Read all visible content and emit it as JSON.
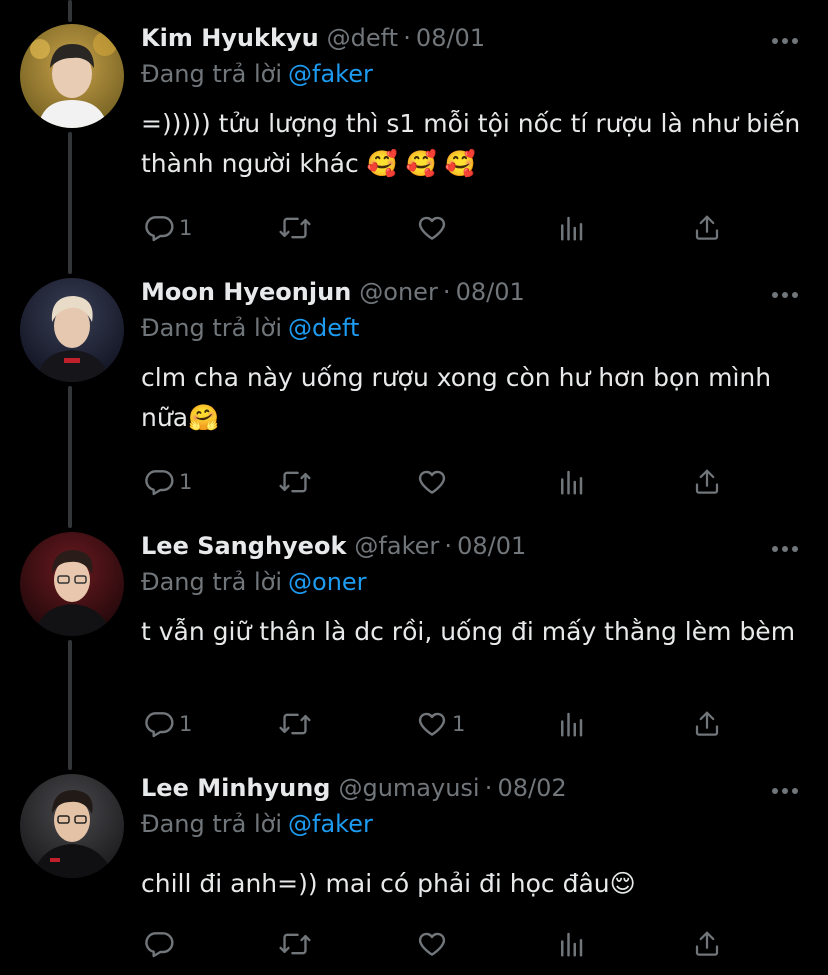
{
  "reply_prefix": "Đang trả lời",
  "tweets": [
    {
      "name": "Kim Hyukkyu",
      "handle": "@deft",
      "dot": "·",
      "date": "08/01",
      "reply_to": "@faker",
      "text": "=))))) tửu lượng thì s1 mỗi tội nốc tí rượu là như biến thành người khác 🥰 🥰 🥰",
      "replies": "1",
      "retweets": "",
      "likes": ""
    },
    {
      "name": "Moon Hyeonjun",
      "handle": "@oner",
      "dot": "·",
      "date": "08/01",
      "reply_to": "@deft",
      "text": "clm cha này uống rượu xong còn hư hơn bọn mình nữa🤗",
      "replies": "1",
      "retweets": "",
      "likes": ""
    },
    {
      "name": "Lee Sanghyeok",
      "handle": "@faker",
      "dot": "·",
      "date": "08/01",
      "reply_to": "@oner",
      "text": "t vẫn giữ thân là dc rồi, uống đi mấy thằng lèm bèm",
      "replies": "1",
      "retweets": "",
      "likes": "1"
    },
    {
      "name": "Lee Minhyung",
      "handle": "@gumayusi",
      "dot": "·",
      "date": "08/02",
      "reply_to": "@faker",
      "text": "chill đi anh=)) mai có phải đi học đâu😌",
      "replies": "",
      "retweets": "",
      "likes": ""
    }
  ],
  "colors": {
    "background": "#000000",
    "text": "#e7e9ea",
    "secondary": "#71767b",
    "mention": "#1d9bf0",
    "thread_line": "#333639"
  },
  "icons": [
    "reply-icon",
    "retweet-icon",
    "like-icon",
    "analytics-icon",
    "share-icon",
    "more-icon"
  ]
}
